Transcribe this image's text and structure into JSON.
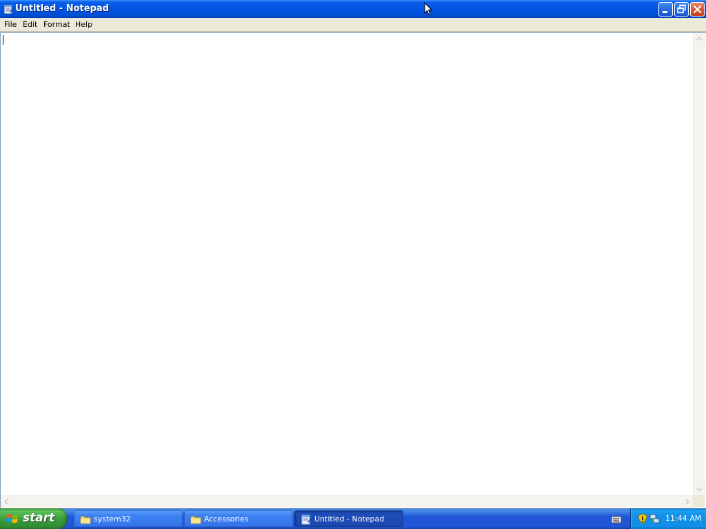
{
  "window": {
    "title": "Untitled - Notepad",
    "buttons": {
      "minimize": "minimize",
      "restore": "restore",
      "close": "close"
    }
  },
  "menu": {
    "items": [
      "File",
      "Edit",
      "Format",
      "Help"
    ]
  },
  "editor": {
    "content": ""
  },
  "taskbar": {
    "start_label": "start",
    "tasks": [
      {
        "label": "system32",
        "icon": "folder-icon",
        "active": false
      },
      {
        "label": "Accessories",
        "icon": "folder-icon",
        "active": false
      },
      {
        "label": "Untitled - Notepad",
        "icon": "notepad-icon",
        "active": true
      }
    ],
    "tray": {
      "icons": [
        "keyboard-icon",
        "security-shield-icon",
        "network-icon"
      ],
      "clock": "11:44 AM"
    }
  },
  "colors": {
    "titlebar": "#0054E3",
    "taskbar": "#2157D7",
    "start_button": "#3A9A3A",
    "tray": "#1290E8",
    "menu_background": "#ECE9D8"
  }
}
